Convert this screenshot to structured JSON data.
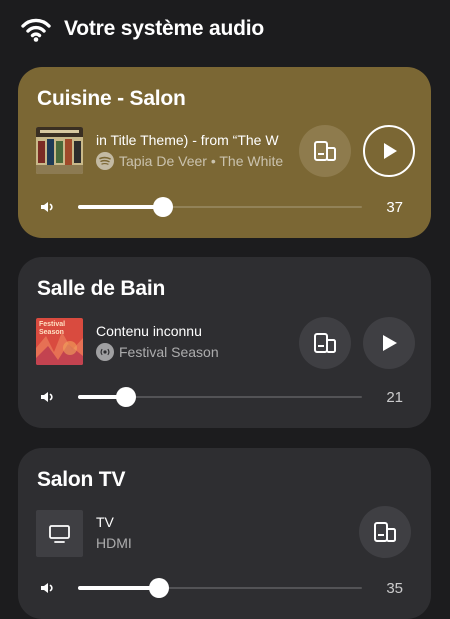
{
  "header": {
    "title": "Votre système audio",
    "icon": "wifi-icon"
  },
  "rooms": [
    {
      "name": "Cuisine - Salon",
      "track_title": "in Title Theme) - from “The W",
      "track_subtitle": "Tapia De Veer • The White",
      "source_badge": "spotify-icon",
      "volume": 37,
      "volume_fraction": 0.37,
      "playing": true,
      "accent": "#7b6734"
    },
    {
      "name": "Salle de Bain",
      "track_title": "Contenu inconnu",
      "track_subtitle": "Festival Season",
      "source_badge": "radio-icon",
      "art_label": "Festival Season",
      "volume": 21,
      "volume_fraction": 0.21,
      "playing": false
    },
    {
      "name": "Salon TV",
      "track_title": "TV",
      "track_subtitle": "HDMI",
      "source_badge": "tv-icon",
      "volume": 35,
      "volume_fraction": 0.35,
      "playing": false
    }
  ]
}
